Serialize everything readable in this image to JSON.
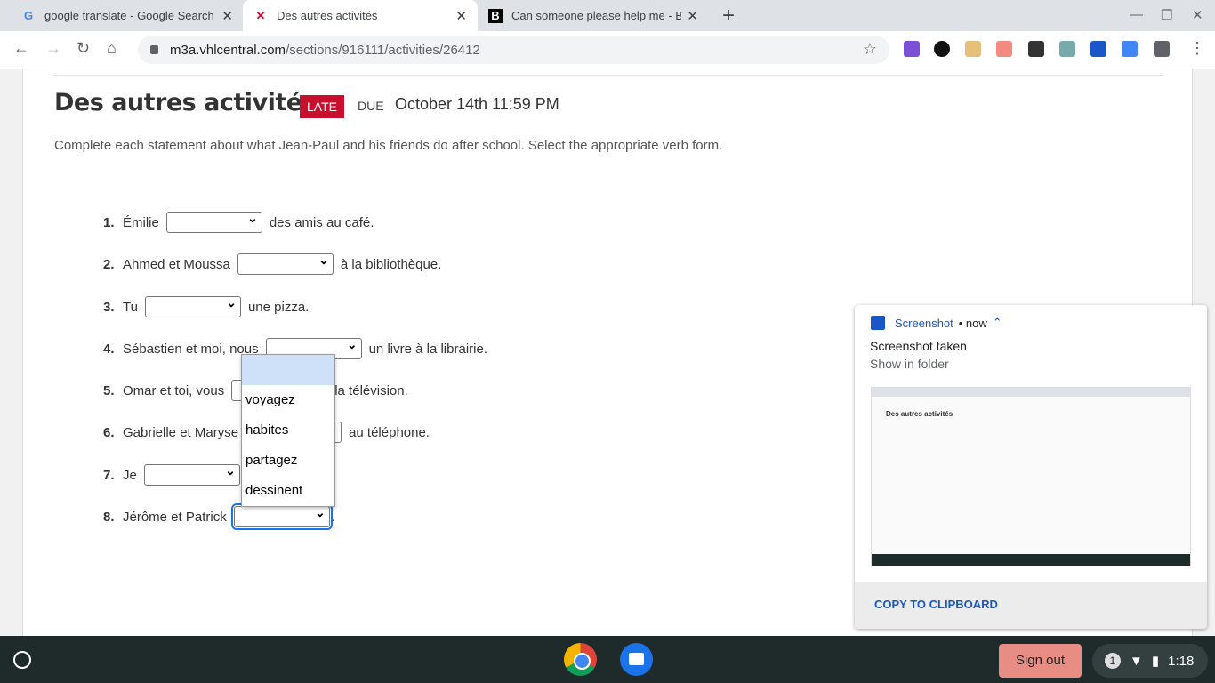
{
  "browser": {
    "tabs": [
      {
        "title": "google translate - Google Search",
        "icon": "G"
      },
      {
        "title": "Des autres activités",
        "icon": "vhl-icon"
      },
      {
        "title": "Can someone please help me - B",
        "icon": "B"
      }
    ],
    "url_host": "m3a.vhlcentral.com",
    "url_path": "/sections/916111/activities/26412"
  },
  "activity": {
    "title": "Des autres activités",
    "late_badge": "LATE",
    "due_label": "DUE",
    "due_date": "October 14th 11:59 PM",
    "instructions": "Complete each statement about what Jean-Paul and his friends do after school. Select the appropriate verb form.",
    "questions": [
      {
        "num": "1.",
        "before": "Émilie",
        "after": "des amis au café."
      },
      {
        "num": "2.",
        "before": "Ahmed et Moussa",
        "after": "à la bibliothèque."
      },
      {
        "num": "3.",
        "before": "Tu",
        "after": "une pizza."
      },
      {
        "num": "4.",
        "before": "Sébastien et moi, nous",
        "after": "un livre à la librairie."
      },
      {
        "num": "5.",
        "before": "Omar et toi, vous",
        "after": "la télévision."
      },
      {
        "num": "6.",
        "before": "Gabrielle et Maryse",
        "after": "au téléphone."
      },
      {
        "num": "7.",
        "before": "Je",
        "after": ""
      },
      {
        "num": "8.",
        "before": "Jérôme et Patrick",
        "after": "."
      }
    ],
    "dropdown_options": [
      "",
      "voyagez",
      "habites",
      "partagez",
      "dessinent"
    ]
  },
  "notification": {
    "app": "Screenshot",
    "time": "• now",
    "title": "Screenshot taken",
    "subtitle": "Show in folder",
    "thumb_title": "Des autres activités",
    "action": "COPY TO CLIPBOARD"
  },
  "shelf": {
    "sign_out": "Sign out",
    "notif_count": "1",
    "time": "1:18"
  }
}
